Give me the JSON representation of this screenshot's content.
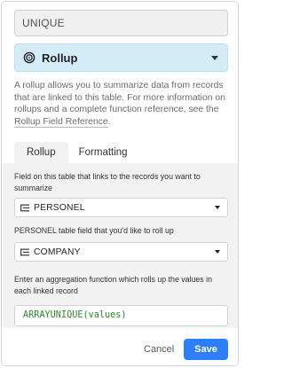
{
  "field_name": {
    "value": "UNIQUE"
  },
  "field_type": {
    "label": "Rollup",
    "icon": "rollup-icon"
  },
  "description": {
    "text": "A rollup allows you to summarize data from records that are linked to this table. For more information on rollups and a complete function reference, see the ",
    "link_text": "Rollup Field Reference",
    "suffix": "."
  },
  "tabs": [
    {
      "label": "Rollup",
      "active": true
    },
    {
      "label": "Formatting",
      "active": false
    }
  ],
  "link_field": {
    "label": "Field on this table that links to the records you want to summarize",
    "value": "PERSONEL",
    "icon": "linked-records-icon"
  },
  "rollup_field": {
    "label": "PERSONEL table field that you'd like to roll up",
    "value": "COMPANY",
    "icon": "linked-records-icon"
  },
  "aggregation": {
    "label": "Enter an aggregation function which rolls up the values in each linked record",
    "formula": "ARRAYUNIQUE(values)"
  },
  "footer": {
    "cancel_label": "Cancel",
    "save_label": "Save"
  },
  "colors": {
    "accent": "#2d7ff9",
    "type_select_bg": "#d4ecf8",
    "formula_text": "#2b8a2b",
    "panel_bg": "#f2f2f2"
  }
}
